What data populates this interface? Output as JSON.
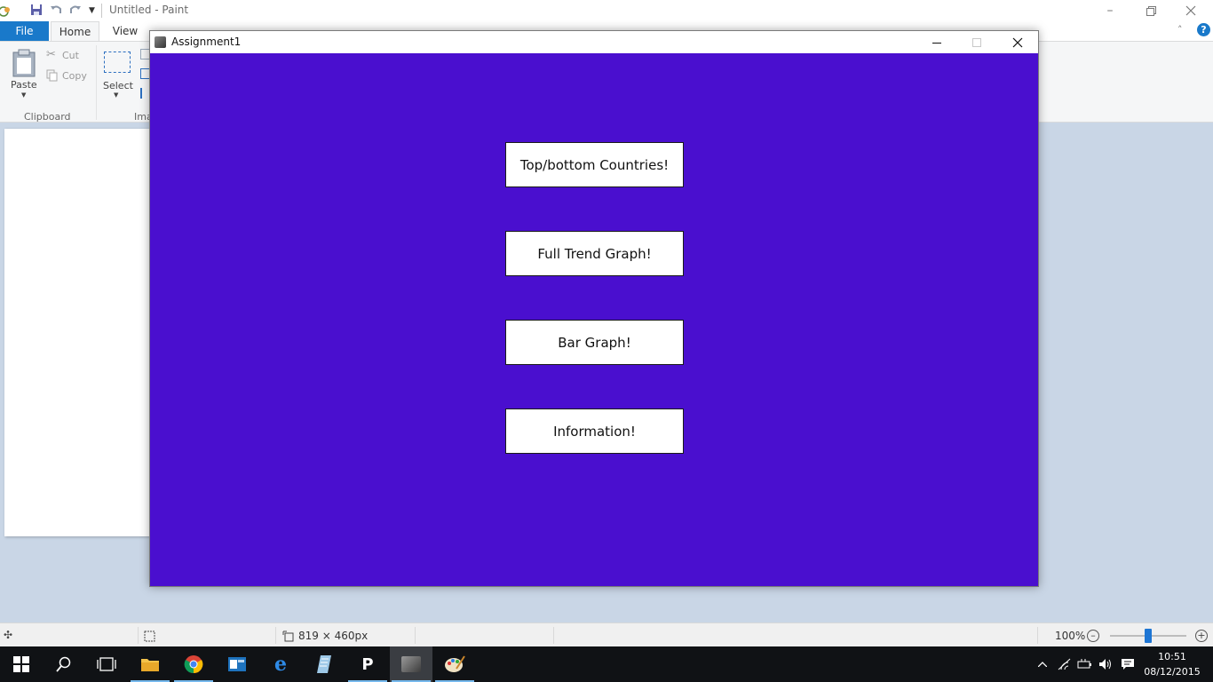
{
  "paint": {
    "title": "Untitled - Paint",
    "tabs": {
      "file": "File",
      "home": "Home",
      "view": "View"
    },
    "ribbon": {
      "paste": "Paste",
      "cut": "Cut",
      "copy": "Copy",
      "select": "Select",
      "clipboard_group": "Clipboard",
      "image_group": "Ima"
    },
    "status": {
      "dimensions": "819 × 460px",
      "zoom": "100%"
    },
    "accent_color": "#1979ca"
  },
  "app_window": {
    "title": "Assignment1",
    "background_color": "#4a0fcf",
    "buttons": [
      {
        "label": "Top/bottom Countries!"
      },
      {
        "label": "Full Trend Graph!"
      },
      {
        "label": "Bar Graph!"
      },
      {
        "label": "Information!"
      }
    ]
  },
  "taskbar": {
    "apps": [
      "start-icon",
      "search-icon",
      "task-view-icon",
      "file-explorer-icon",
      "chrome-icon",
      "outlook-icon",
      "edge-icon",
      "notepad-icon",
      "p-app-icon",
      "java-app-icon",
      "paint-icon"
    ],
    "clock": {
      "time": "10:51",
      "date": "08/12/2015"
    }
  }
}
